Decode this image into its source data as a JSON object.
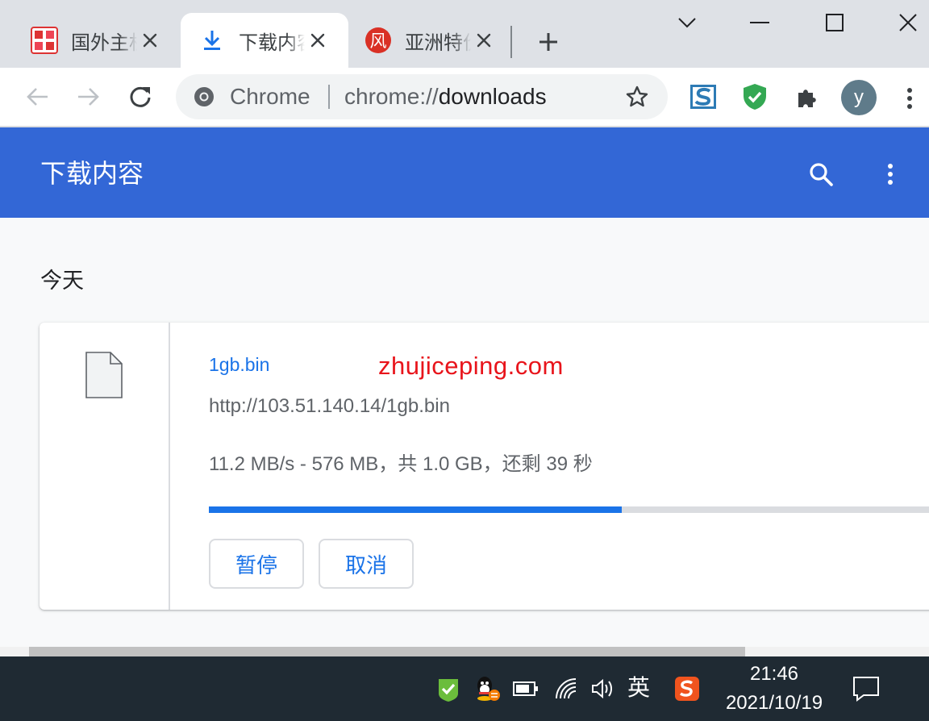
{
  "tabs": [
    {
      "title": "国外主机"
    },
    {
      "title": "下载内容"
    },
    {
      "title": "亚洲特价"
    }
  ],
  "toolbar": {
    "chip": "Chrome",
    "url_scheme": "chrome://",
    "url_path": "downloads",
    "avatar_letter": "y"
  },
  "downloads": {
    "title": "下载内容",
    "date_heading": "今天",
    "item": {
      "filename": "1gb.bin",
      "url": "http://103.51.140.14/1gb.bin",
      "status": "11.2 MB/s - 576 MB，共 1.0 GB，还剩 39 秒",
      "progress": 0.5625,
      "pause_label": "暂停",
      "cancel_label": "取消"
    },
    "watermark": "zhujiceping.com"
  },
  "taskbar": {
    "ime": "英",
    "time": "21:46",
    "date": "2021/10/19"
  },
  "colors": {
    "header": "#3367d6",
    "accent": "#1a73e8",
    "watermark": "#e8141b",
    "taskbar": "#1f2a33"
  },
  "icons": [
    "download-icon",
    "close-icon",
    "plus-icon",
    "minimize-icon",
    "maximize-icon",
    "chevron-down-icon",
    "back-arrow-icon",
    "forward-arrow-icon",
    "reload-icon",
    "chrome-icon",
    "star-icon",
    "puzzle-icon",
    "search-icon",
    "more-vert-icon",
    "file-icon",
    "wifi-icon",
    "volume-icon",
    "battery-icon",
    "notification-icon"
  ]
}
